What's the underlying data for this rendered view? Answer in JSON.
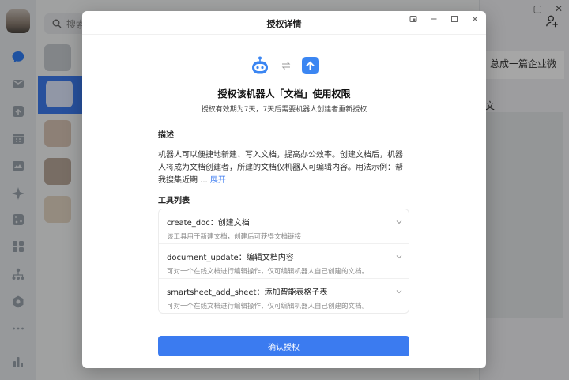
{
  "background": {
    "search_placeholder": "搜索",
    "banner_text": "总成一篇企业微",
    "side_text": "文"
  },
  "modal": {
    "title": "授权详情",
    "heading": "授权该机器人「文档」使用权限",
    "subheading": "授权有效期为7天，7天后需要机器人创建者重新授权",
    "description": {
      "title": "描述",
      "text": "机器人可以便捷地新建、写入文档，提高办公效率。创建文档后，机器人将成为文档创建者，所建的文档仅机器人可编辑内容。用法示例：帮我搜集近期 ...",
      "expand_label": "展开"
    },
    "tools": {
      "title": "工具列表",
      "items": [
        {
          "name": "create_doc：创建文档",
          "desc": "该工具用于新建文档，创建后可获得文档链接"
        },
        {
          "name": "document_update：编辑文档内容",
          "desc": "可对一个在线文档进行编辑操作，仅可编辑机器人自己创建的文档。"
        },
        {
          "name": "smartsheet_add_sheet：添加智能表格子表",
          "desc": "可对一个在线文档进行编辑操作，仅可编辑机器人自己创建的文档。"
        }
      ]
    },
    "confirm_label": "确认授权"
  },
  "colors": {
    "accent": "#3b7bf0",
    "doc_icon": "#3b86f2"
  },
  "icons": [
    "chat-icon",
    "mail-icon",
    "doc-icon",
    "calendar-icon",
    "meeting-icon",
    "sparkle-icon",
    "workbench-icon",
    "apps-icon",
    "org-icon",
    "cube-icon",
    "more-icon",
    "stats-icon",
    "robot-icon",
    "swap-icon",
    "chevron-down-icon",
    "close-icon",
    "minimize-icon",
    "pip-icon",
    "add-contact-icon",
    "search-icon"
  ]
}
